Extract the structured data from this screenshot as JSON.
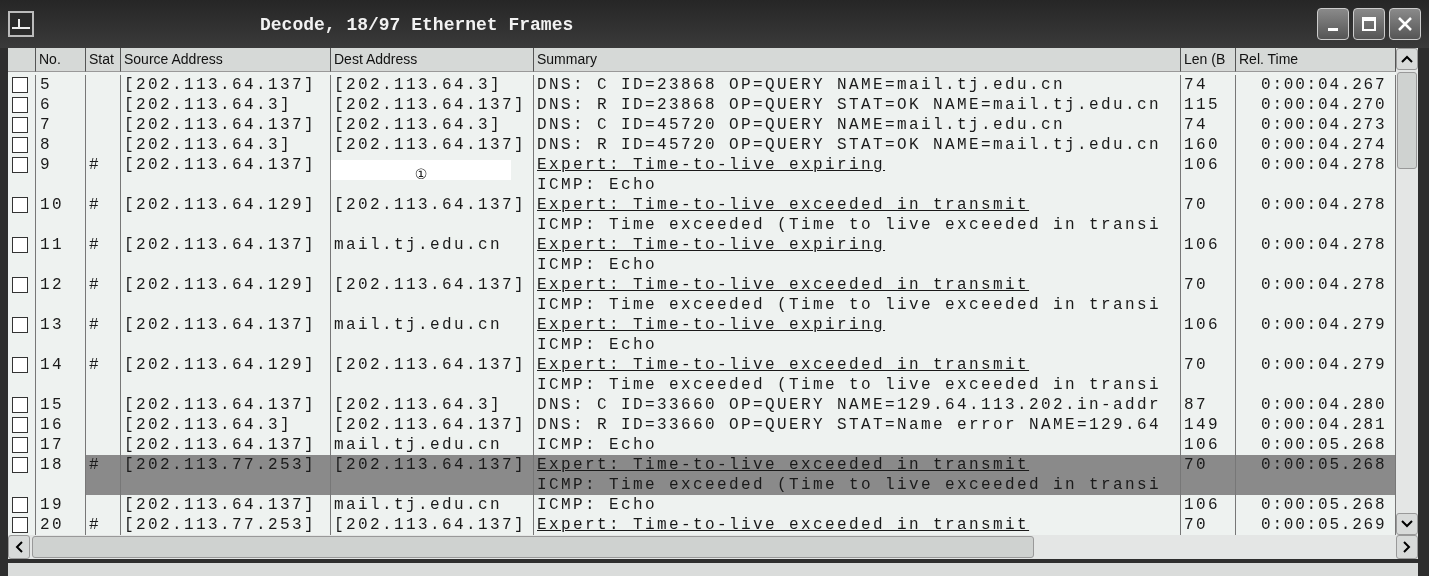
{
  "window": {
    "title": "Decode, 18/97 Ethernet Frames"
  },
  "table": {
    "columns": [
      "No.",
      "Stat",
      "Source Address",
      "Dest Address",
      "Summary",
      "Len (B",
      "Rel. Time"
    ],
    "rows": [
      {
        "no": "5",
        "checked": false,
        "selected": false,
        "source": "[202.113.64.137]",
        "dest": "[202.113.64.3]",
        "summary": [
          {
            "kind": "plain",
            "text": "DNS: C ID=23868 OP=QUERY NAME=mail.tj.edu.cn"
          }
        ],
        "len": "74",
        "time": "0:00:04.267"
      },
      {
        "no": "6",
        "checked": false,
        "selected": false,
        "source": "[202.113.64.3]",
        "dest": "[202.113.64.137]",
        "summary": [
          {
            "kind": "plain",
            "text": "DNS: R ID=23868 OP=QUERY STAT=OK NAME=mail.tj.edu.cn"
          }
        ],
        "len": "115",
        "time": "0:00:04.270"
      },
      {
        "no": "7",
        "checked": false,
        "selected": false,
        "source": "[202.113.64.137]",
        "dest": "[202.113.64.3]",
        "summary": [
          {
            "kind": "plain",
            "text": "DNS: C ID=45720 OP=QUERY NAME=mail.tj.edu.cn"
          }
        ],
        "len": "74",
        "time": "0:00:04.273"
      },
      {
        "no": "8",
        "checked": false,
        "selected": false,
        "source": "[202.113.64.3]",
        "dest": "[202.113.64.137]",
        "summary": [
          {
            "kind": "plain",
            "text": "DNS: R ID=45720 OP=QUERY STAT=OK NAME=mail.tj.edu.cn"
          }
        ],
        "len": "160",
        "time": "0:00:04.274"
      },
      {
        "no": "9",
        "checked": false,
        "selected": false,
        "stat": "#",
        "source": "[202.113.64.137]",
        "dest_cover": "①",
        "summary": [
          {
            "kind": "expert",
            "text": "Expert: Time-to-live expiring"
          },
          {
            "kind": "plain",
            "text": "ICMP: Echo"
          }
        ],
        "len": "106",
        "time": "0:00:04.278"
      },
      {
        "no": "10",
        "checked": false,
        "selected": false,
        "stat": "#",
        "source": "[202.113.64.129]",
        "dest": "[202.113.64.137]",
        "summary": [
          {
            "kind": "expert",
            "text": "Expert: Time-to-live exceeded in transmit"
          },
          {
            "kind": "plain",
            "text": "ICMP: Time exceeded (Time to live exceeded in transi"
          }
        ],
        "len": "70",
        "time": "0:00:04.278"
      },
      {
        "no": "11",
        "checked": false,
        "selected": false,
        "stat": "#",
        "source": "[202.113.64.137]",
        "dest": "mail.tj.edu.cn",
        "summary": [
          {
            "kind": "expert",
            "text": "Expert: Time-to-live expiring"
          },
          {
            "kind": "plain",
            "text": "ICMP: Echo"
          }
        ],
        "len": "106",
        "time": "0:00:04.278"
      },
      {
        "no": "12",
        "checked": false,
        "selected": false,
        "stat": "#",
        "source": "[202.113.64.129]",
        "dest": "[202.113.64.137]",
        "summary": [
          {
            "kind": "expert",
            "text": "Expert: Time-to-live exceeded in transmit"
          },
          {
            "kind": "plain",
            "text": "ICMP: Time exceeded (Time to live exceeded in transi"
          }
        ],
        "len": "70",
        "time": "0:00:04.278"
      },
      {
        "no": "13",
        "checked": false,
        "selected": false,
        "stat": "#",
        "source": "[202.113.64.137]",
        "dest": "mail.tj.edu.cn",
        "summary": [
          {
            "kind": "expert",
            "text": "Expert: Time-to-live expiring"
          },
          {
            "kind": "plain",
            "text": "ICMP: Echo"
          }
        ],
        "len": "106",
        "time": "0:00:04.279"
      },
      {
        "no": "14",
        "checked": false,
        "selected": false,
        "stat": "#",
        "source": "[202.113.64.129]",
        "dest": "[202.113.64.137]",
        "summary": [
          {
            "kind": "expert",
            "text": "Expert: Time-to-live exceeded in transmit"
          },
          {
            "kind": "plain",
            "text": "ICMP: Time exceeded (Time to live exceeded in transi"
          }
        ],
        "len": "70",
        "time": "0:00:04.279"
      },
      {
        "no": "15",
        "checked": false,
        "selected": false,
        "source": "[202.113.64.137]",
        "dest": "[202.113.64.3]",
        "summary": [
          {
            "kind": "plain",
            "text": "DNS: C ID=33660 OP=QUERY NAME=129.64.113.202.in-addr"
          }
        ],
        "len": "87",
        "time": "0:00:04.280"
      },
      {
        "no": "16",
        "checked": false,
        "selected": false,
        "source": "[202.113.64.3]",
        "dest": "[202.113.64.137]",
        "summary": [
          {
            "kind": "plain",
            "text": "DNS: R ID=33660 OP=QUERY STAT=Name error NAME=129.64"
          }
        ],
        "len": "149",
        "time": "0:00:04.281"
      },
      {
        "no": "17",
        "checked": false,
        "selected": false,
        "source": "[202.113.64.137]",
        "dest": "mail.tj.edu.cn",
        "summary": [
          {
            "kind": "plain",
            "text": "ICMP: Echo"
          }
        ],
        "len": "106",
        "time": "0:00:05.268"
      },
      {
        "no": "18",
        "checked": false,
        "selected": true,
        "stat": "#",
        "source": "[202.113.77.253]",
        "dest": "[202.113.64.137]",
        "summary": [
          {
            "kind": "expert",
            "text": "Expert: Time-to-live exceeded in transmit"
          },
          {
            "kind": "plain",
            "text": "ICMP: Time exceeded (Time to live exceeded in transi"
          }
        ],
        "len": "70",
        "time": "0:00:05.268"
      },
      {
        "no": "19",
        "checked": false,
        "selected": false,
        "source": "[202.113.64.137]",
        "dest": "mail.tj.edu.cn",
        "summary": [
          {
            "kind": "plain",
            "text": "ICMP: Echo"
          }
        ],
        "len": "106",
        "time": "0:00:05.268"
      },
      {
        "no": "20",
        "checked": false,
        "selected": false,
        "stat": "#",
        "source": "[202.113.77.253]",
        "dest": "[202.113.64.137]",
        "summary": [
          {
            "kind": "expert",
            "text": "Expert: Time-to-live exceeded in transmit"
          }
        ],
        "len": "70",
        "time": "0:00:05.269"
      }
    ]
  }
}
